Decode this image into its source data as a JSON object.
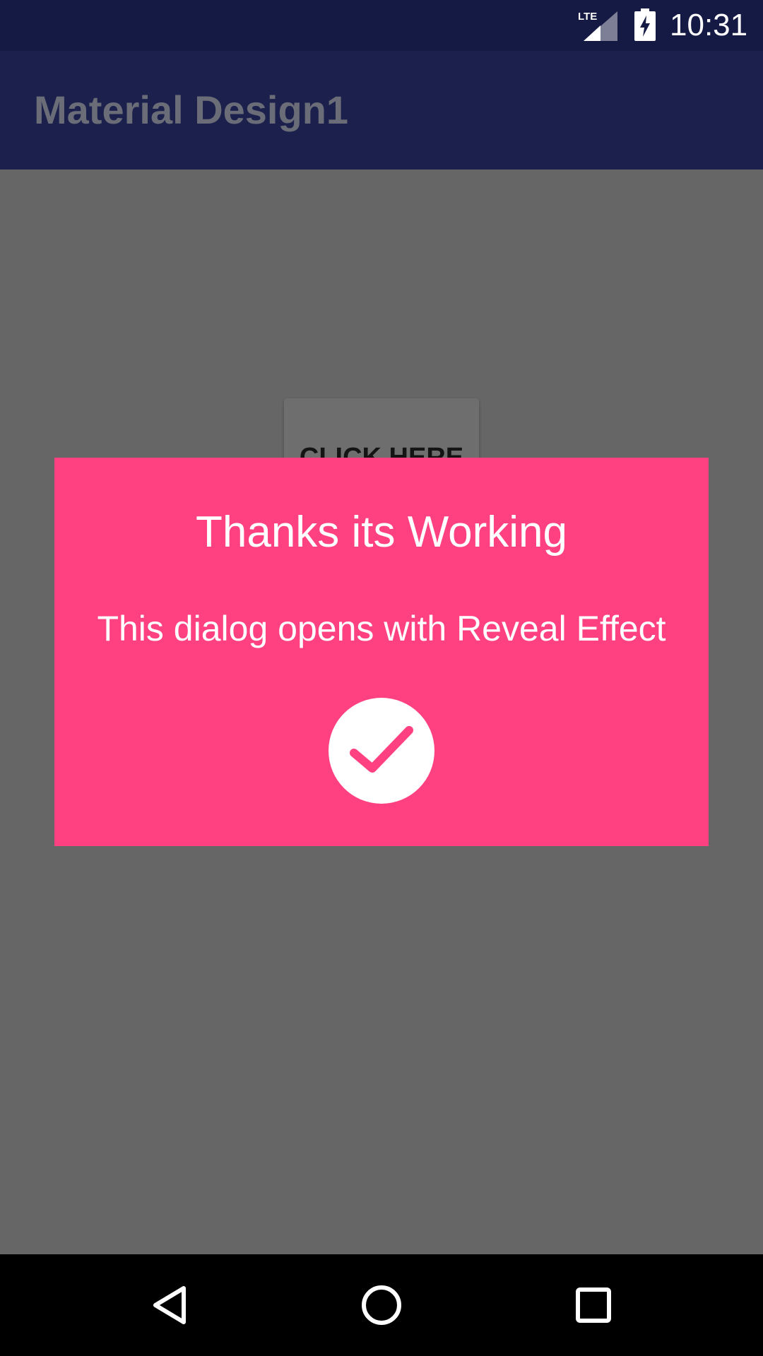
{
  "status_bar": {
    "network_label": "LTE",
    "time": "10:31",
    "icons": [
      "lte-signal-icon",
      "battery-charging-icon"
    ],
    "background_color": "#151a45"
  },
  "app_bar": {
    "title": "Material Design1",
    "background_color": "#1b204c"
  },
  "content": {
    "button_label": "CLICK HERE",
    "scrim_color": "#666666"
  },
  "dialog": {
    "title": "Thanks its Working",
    "message": "This dialog opens with Reveal Effect",
    "confirm_icon": "checkmark-icon",
    "background_color": "#ff4081"
  },
  "nav_bar": {
    "icons": [
      "back-icon",
      "home-icon",
      "recents-icon"
    ]
  }
}
